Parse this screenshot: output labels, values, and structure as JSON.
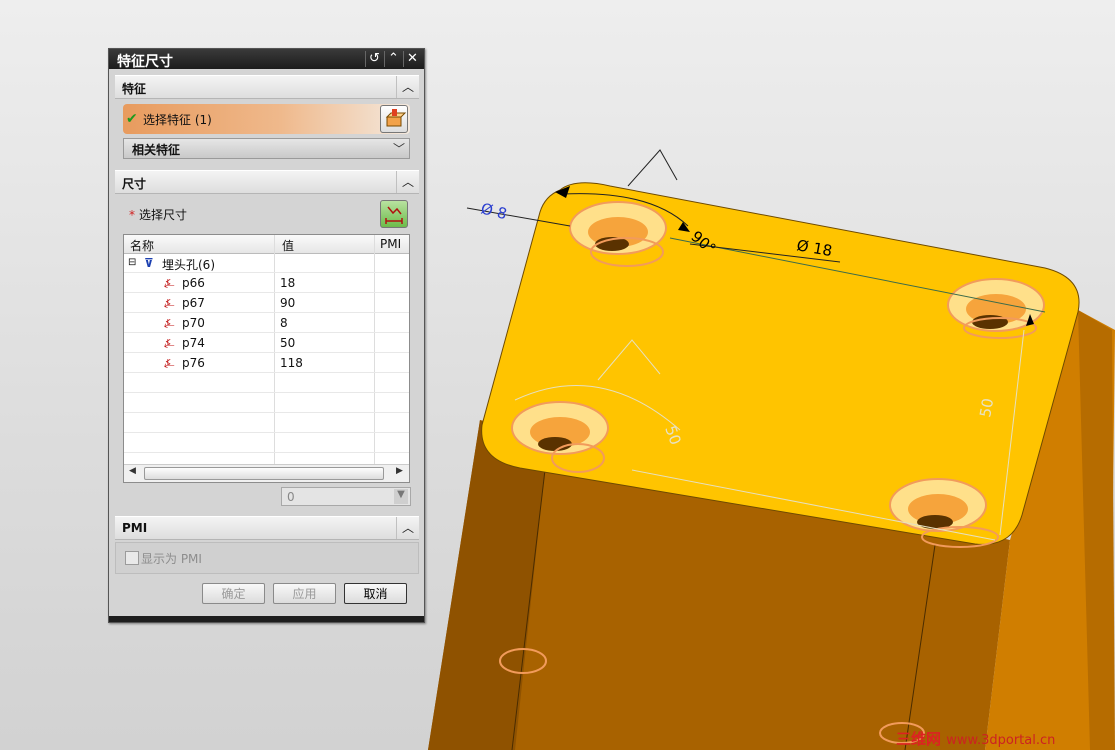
{
  "dialog": {
    "title": "特征尺寸",
    "sections": {
      "feature": {
        "header": "特征",
        "select_label": "选择特征 (1)",
        "related_label": "相关特征"
      },
      "dimension": {
        "header": "尺寸",
        "select_label": "选择尺寸",
        "table": {
          "columns": [
            "名称",
            "值",
            "PMI"
          ],
          "parent": "埋头孔(6)",
          "rows": [
            {
              "name": "p66",
              "value": "18"
            },
            {
              "name": "p67",
              "value": "90"
            },
            {
              "name": "p70",
              "value": "8"
            },
            {
              "name": "p74",
              "value": "50"
            },
            {
              "name": "p76",
              "value": "118"
            }
          ]
        },
        "value_field": "0"
      },
      "pmi": {
        "header": "PMI",
        "checkbox_label": "显示为 PMI"
      }
    },
    "buttons": {
      "ok": "确定",
      "apply": "应用",
      "cancel": "取消"
    }
  },
  "viewport": {
    "dimension_labels": {
      "dia8": "Ø 8",
      "dia18": "Ø 18",
      "angle90": "90°",
      "dim50_a": "50",
      "dim50_b": "50"
    },
    "colors": {
      "part_top": "#ffc400",
      "part_side": "#d98a00",
      "part_front": "#a05f00",
      "hole": "#f6b24a",
      "highlight": "#f29b5b"
    }
  },
  "watermark": {
    "brand": "三维网",
    "url": "www.3dportal.cn"
  }
}
